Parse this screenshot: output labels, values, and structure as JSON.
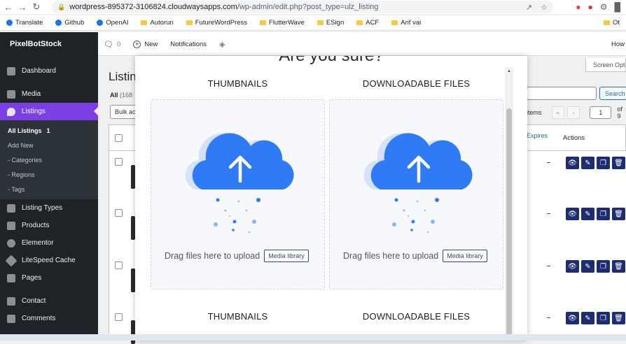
{
  "browser": {
    "url_host": "wordpress-895372-3106824.cloudwaysapps.com",
    "url_path": "/wp-admin/edit.php?post_type=ulz_listing",
    "bookmarks": [
      {
        "label": "Translate",
        "icon": "translate-icon"
      },
      {
        "label": "Github",
        "icon": "github-icon"
      },
      {
        "label": "OpenAI",
        "icon": "openai-icon"
      },
      {
        "label": "Autorun",
        "icon": "folder-icon"
      },
      {
        "label": "FutureWordPress",
        "icon": "folder-icon"
      },
      {
        "label": "FlutterWave",
        "icon": "folder-icon"
      },
      {
        "label": "ESign",
        "icon": "folder-icon"
      },
      {
        "label": "ACF",
        "icon": "folder-icon"
      },
      {
        "label": "Arif vai",
        "icon": "folder-icon"
      },
      {
        "label": "Ot",
        "icon": "folder-icon"
      }
    ]
  },
  "admin_bar": {
    "brand": "PixelBotStock",
    "comments_count": "0",
    "new_label": "New",
    "notifications_label": "Notifications",
    "howdy": "How"
  },
  "sidebar": {
    "items": [
      {
        "label": "Dashboard",
        "icon": "dashboard-icon"
      },
      {
        "label": "Media",
        "icon": "media-icon"
      },
      {
        "label": "Listings",
        "icon": "location-pin-icon",
        "active": true
      },
      {
        "label": "Listing Types",
        "icon": "grid-icon"
      },
      {
        "label": "Products",
        "icon": "products-icon"
      },
      {
        "label": "Elementor",
        "icon": "elementor-icon"
      },
      {
        "label": "LiteSpeed Cache",
        "icon": "litespeed-icon"
      },
      {
        "label": "Pages",
        "icon": "pages-icon"
      },
      {
        "label": "Contact",
        "icon": "mail-icon"
      },
      {
        "label": "Comments",
        "icon": "comments-icon"
      }
    ],
    "submenu": [
      {
        "label": "All Listings",
        "badge": "1",
        "current": true
      },
      {
        "label": "Add New"
      },
      {
        "label": "- Categories"
      },
      {
        "label": "- Regions"
      },
      {
        "label": "- Tags"
      }
    ]
  },
  "page": {
    "title": "Listin",
    "filter_all": "All",
    "filter_count": "(168",
    "bulk_label": "Bulk ac",
    "screen_options": "Screen Opti",
    "search_button": "Search",
    "items_label": "items",
    "current_page": "1",
    "of_pages": "of 9",
    "col_expires": "Expires",
    "col_actions": "Actions"
  },
  "modal": {
    "title": "Are you sure?",
    "sections": [
      {
        "heading": "THUMBNAILS",
        "drop_text": "Drag files here to upload",
        "button": "Media library"
      },
      {
        "heading": "DOWNLOADABLE FILES",
        "drop_text": "Drag files here to upload",
        "button": "Media library"
      }
    ],
    "bottom_headings": [
      "THUMBNAILS",
      "DOWNLOADABLE FILES"
    ]
  },
  "colors": {
    "sidebar_bg": "#1d2327",
    "active_menu": "#7b3fe4",
    "cloud": "#2f7af5",
    "action_btn": "#1f2c6f"
  }
}
